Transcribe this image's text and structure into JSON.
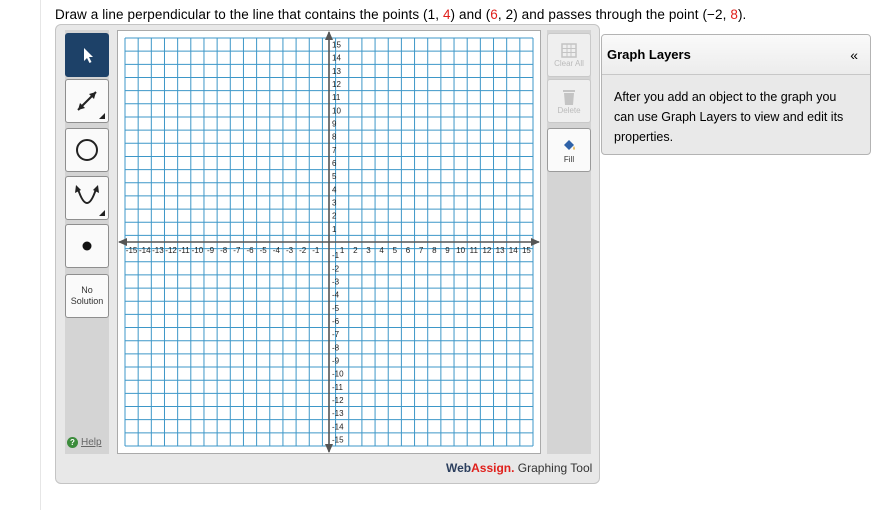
{
  "question": {
    "p1": "Draw a line perpendicular to the line that contains the points ",
    "pt1_open": "(1, ",
    "pt1_y": "4",
    "pt1_close": ")",
    "and1": " and ",
    "pt2_open": "(",
    "pt2_x": "6",
    "pt2_mid": ", 2)",
    "p2": " and passes through the point ",
    "pt3_open": "(−2, ",
    "pt3_y": "8",
    "pt3_close": ")."
  },
  "toolbar": {
    "tools": [
      {
        "name": "pointer-tool",
        "icon": "pointer-arrow-icon",
        "active": true
      },
      {
        "name": "line-tool",
        "icon": "line-arrows-icon"
      },
      {
        "name": "circle-tool",
        "icon": "circle-icon"
      },
      {
        "name": "parabola-tool",
        "icon": "parabola-icon"
      },
      {
        "name": "point-tool",
        "icon": "point-dot-icon"
      }
    ],
    "no_solution_line1": "No",
    "no_solution_line2": "Solution",
    "help_label": "Help"
  },
  "actions": {
    "clear_all_label": "Clear All",
    "delete_label": "Delete",
    "fill_label": "Fill"
  },
  "graph": {
    "x_min": -15,
    "x_max": 15,
    "y_min": -15,
    "y_max": 15,
    "grid": true,
    "x_tick_labels": [
      "-15",
      "-14",
      "-13",
      "-12",
      "-11",
      "-10",
      "-9",
      "-8",
      "-7",
      "-6",
      "-5",
      "-4",
      "-3",
      "-2",
      "-1",
      "1",
      "2",
      "3",
      "4",
      "5",
      "6",
      "7",
      "8",
      "9",
      "10",
      "11",
      "12",
      "13",
      "14",
      "15"
    ],
    "y_tick_labels": [
      "15",
      "14",
      "13",
      "12",
      "11",
      "10",
      "9",
      "8",
      "7",
      "6",
      "5",
      "4",
      "3",
      "2",
      "1",
      "-1",
      "-2",
      "-3",
      "-4",
      "-5",
      "-6",
      "-7",
      "-8",
      "-9",
      "-10",
      "-11",
      "-12",
      "-13",
      "-14",
      "-15"
    ],
    "colors": {
      "grid": "#3d97c8",
      "axis": "#555555",
      "background": "#ffffff"
    }
  },
  "brand": {
    "web": "Web",
    "assign": "Assign.",
    "tool": " Graphing Tool"
  },
  "layers_panel": {
    "title": "Graph Layers",
    "collapse_icon": "«",
    "text": "After you add an object to the graph you can use Graph Layers to view and edit its properties."
  }
}
